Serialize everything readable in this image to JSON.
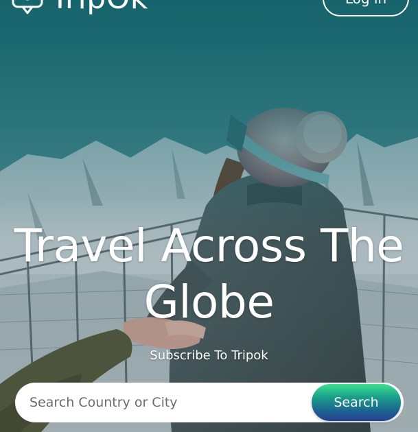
{
  "header": {
    "logo_text": "TripOk",
    "login_label": "Log in"
  },
  "hero": {
    "title": "Travel Across The Globe",
    "subtitle": "Subscribe To Tripok"
  },
  "search": {
    "placeholder": "Search Country or City",
    "value": "",
    "button_label": "Search"
  },
  "icons": {
    "logo": "chat-bubble-location-icon"
  },
  "colors": {
    "overlay": "#105c64",
    "search_button_top": "#3fe08f",
    "search_button_bottom": "#27408e",
    "text": "#ffffff"
  }
}
